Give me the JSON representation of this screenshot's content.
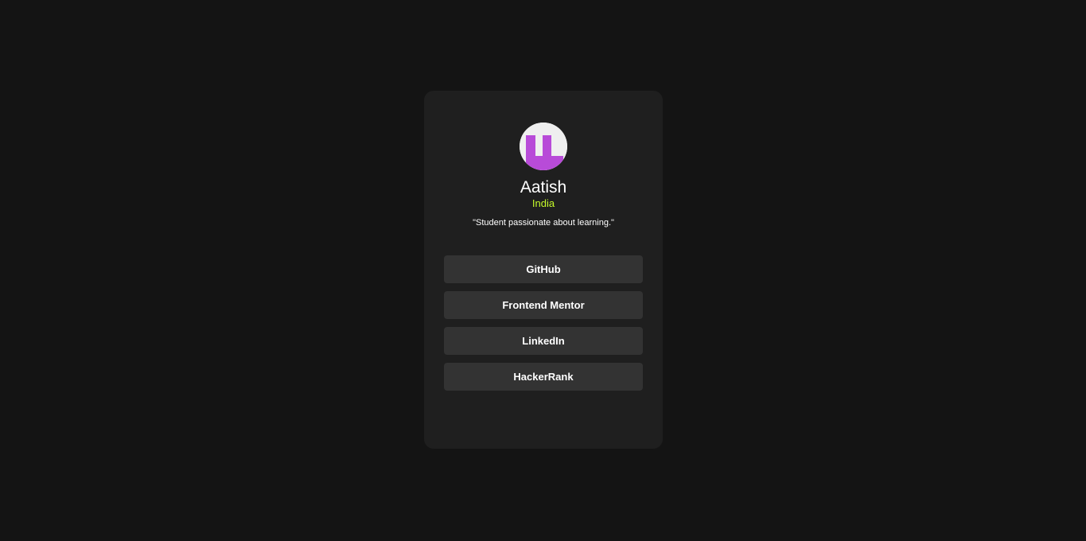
{
  "profile": {
    "avatar_icon": "purple-block-avatar-icon",
    "avatar_background": "#efefef",
    "avatar_color": "#b84bd8",
    "name": "Aatish",
    "location": "India",
    "bio": "\"Student passionate about learning.\""
  },
  "links": [
    {
      "label": "GitHub"
    },
    {
      "label": "Frontend Mentor"
    },
    {
      "label": "LinkedIn"
    },
    {
      "label": "HackerRank"
    }
  ],
  "colors": {
    "page_background": "#141414",
    "card_background": "#1f1f1f",
    "button_background": "#333333",
    "accent": "#c4f82a",
    "text": "#ffffff"
  }
}
